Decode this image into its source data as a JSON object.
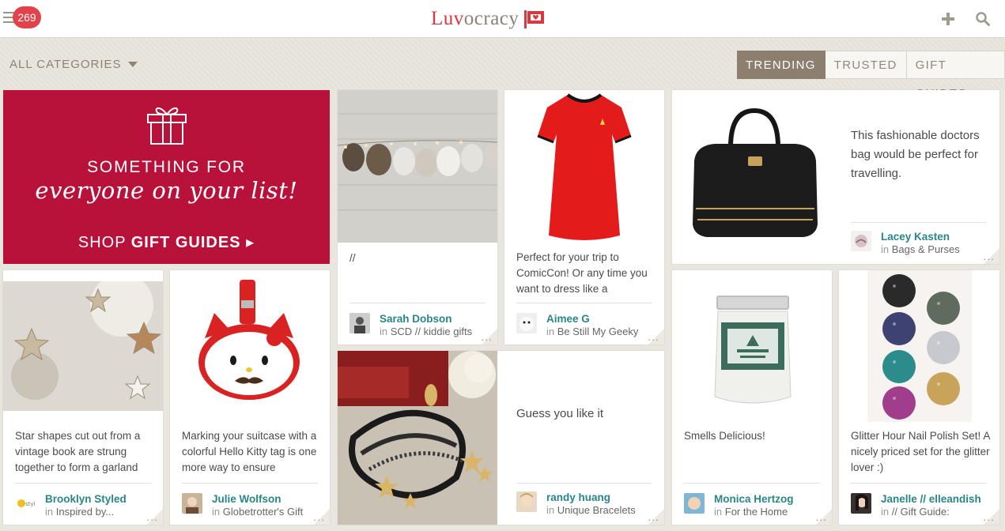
{
  "header": {
    "notification_count": "269",
    "logo_luv": "Luv",
    "logo_rest": "ocracy",
    "icons": [
      "menu-icon",
      "plus-icon",
      "search-icon"
    ]
  },
  "filters": {
    "categories_label": "ALL CATEGORIES",
    "tabs": [
      {
        "label": "TRENDING",
        "active": true
      },
      {
        "label": "TRUSTED",
        "active": false
      },
      {
        "label": "GIFT GUIDES",
        "active": false
      }
    ]
  },
  "promo": {
    "line1": "SOMETHING FOR",
    "line2": "everyone on your list!",
    "cta_prefix": "SHOP ",
    "cta_bold": "GIFT GUIDES",
    "cta_arrow": "▸"
  },
  "cards": [
    {
      "caption": "//",
      "user": "Sarah Dobson",
      "collection": "SCD // kiddie gifts"
    },
    {
      "caption": "Perfect for your trip to ComicCon! Or any time you want to dress like a",
      "user": "Aimee G",
      "collection": "Be Still My Geeky"
    },
    {
      "caption": "This fashionable doctors bag would be perfect for travelling.",
      "user": "Lacey Kasten",
      "collection": "Bags & Purses"
    },
    {
      "caption": "Star shapes cut out from a vintage book are strung together to form a garland",
      "user": "Brooklyn Styled",
      "collection": "Inspired by..."
    },
    {
      "caption": "Marking your suitcase with a colorful Hello Kitty tag is one more way to ensure",
      "user": "Julie Wolfson",
      "collection": "Globetrotter's Gift"
    },
    {
      "caption": "Guess you like it",
      "user": "randy huang",
      "collection": "Unique Bracelets"
    },
    {
      "caption": "Smells Delicious!",
      "user": "Monica Hertzog",
      "collection": "For the Home"
    },
    {
      "caption": "Glitter Hour Nail Polish Set! A nicely priced set for the glitter lover :)",
      "user": "Janelle // elleandish",
      "collection": "// Gift Guide:"
    }
  ],
  "in_label": "in",
  "more_label": "..."
}
